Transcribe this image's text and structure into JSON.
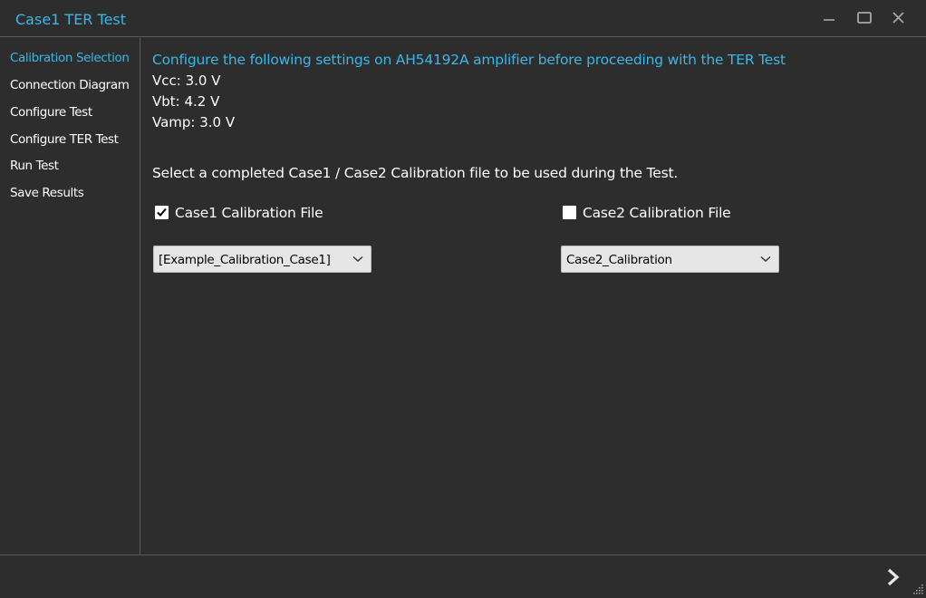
{
  "window": {
    "title": "Case1 TER Test",
    "accent_color": "#3ab7e8",
    "background_color": "#2d2d2d",
    "controls": [
      "minimize-icon",
      "maximize-icon",
      "close-icon"
    ]
  },
  "sidebar": {
    "items": [
      {
        "label": "Calibration Selection",
        "active": true
      },
      {
        "label": "Connection Diagram",
        "active": false
      },
      {
        "label": "Configure Test",
        "active": false
      },
      {
        "label": "Configure TER Test",
        "active": false
      },
      {
        "label": "Run Test",
        "active": false
      },
      {
        "label": "Save Results",
        "active": false
      }
    ]
  },
  "main": {
    "heading": "Configure the following settings on AH54192A amplifier before proceeding with the TER Test",
    "settings": [
      "Vcc: 3.0 V",
      "Vbt: 4.2 V",
      "Vamp: 3.0 V"
    ],
    "instruction": "Select a completed Case1 / Case2 Calibration file to be used during the Test.",
    "case1": {
      "checkbox_label": "Case1 Calibration File",
      "checked": true,
      "selected_file": "[Example_Calibration_Case1]"
    },
    "case2": {
      "checkbox_label": "Case2 Calibration File",
      "checked": false,
      "selected_file": "Case2_Calibration"
    }
  },
  "footer": {
    "next_icon": "chevron-right-icon",
    "resize_icon": "resize-grip-icon"
  }
}
